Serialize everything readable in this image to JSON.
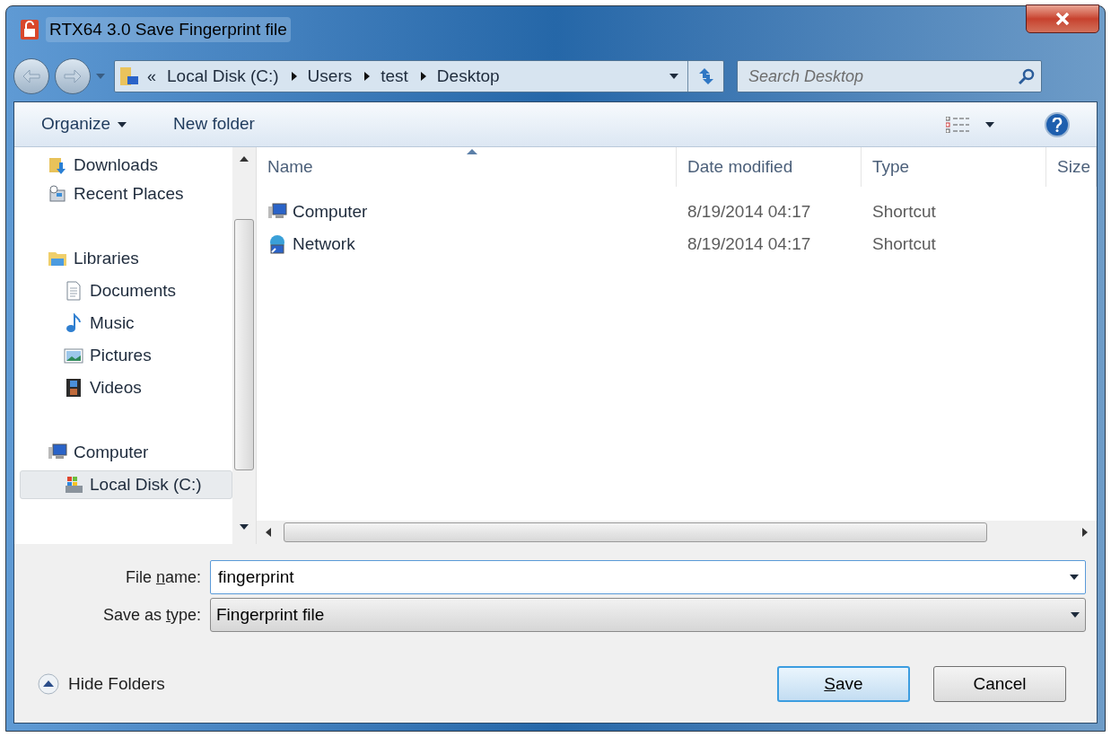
{
  "window": {
    "title": "RTX64 3.0  Save Fingerprint file"
  },
  "address": {
    "prefix": "«",
    "crumbs": [
      "Local Disk (C:)",
      "Users",
      "test",
      "Desktop"
    ]
  },
  "search": {
    "placeholder": "Search Desktop"
  },
  "toolbar": {
    "organize": "Organize",
    "new_folder": "New folder"
  },
  "sidebar": {
    "items": [
      {
        "label": "Downloads",
        "kind": "downloads",
        "selected": false
      },
      {
        "label": "Recent Places",
        "kind": "recent",
        "selected": false
      },
      {
        "label": "Libraries",
        "kind": "library",
        "selected": false,
        "children": [
          {
            "label": "Documents",
            "kind": "documents",
            "selected": false
          },
          {
            "label": "Music",
            "kind": "music",
            "selected": false
          },
          {
            "label": "Pictures",
            "kind": "pictures",
            "selected": false
          },
          {
            "label": "Videos",
            "kind": "videos",
            "selected": false
          }
        ]
      },
      {
        "label": "Computer",
        "kind": "computer",
        "selected": false,
        "children": [
          {
            "label": "Local Disk (C:)",
            "kind": "drive",
            "selected": true
          }
        ]
      }
    ]
  },
  "table": {
    "columns": [
      {
        "label": "Name",
        "sorted": true
      },
      {
        "label": "Date modified",
        "sorted": false
      },
      {
        "label": "Type",
        "sorted": false
      },
      {
        "label": "Size",
        "sorted": false
      }
    ],
    "rows": [
      {
        "name": "Computer",
        "kind": "computer",
        "date": "8/19/2014 04:17",
        "type": "Shortcut"
      },
      {
        "name": "Network",
        "kind": "network",
        "date": "8/19/2014 04:17",
        "type": "Shortcut"
      }
    ]
  },
  "file_name": {
    "label": {
      "before": "File ",
      "key": "n",
      "after": "ame:"
    },
    "value": "fingerprint"
  },
  "save_type": {
    "label": {
      "before": "Save as ",
      "key": "t",
      "after": "ype:"
    },
    "value": "Fingerprint file"
  },
  "hide_folders": "Hide Folders",
  "buttons": [
    {
      "label": {
        "key": "S",
        "after": "ave"
      },
      "default": true
    },
    {
      "label": {
        "before": "Cancel"
      },
      "default": false
    }
  ]
}
